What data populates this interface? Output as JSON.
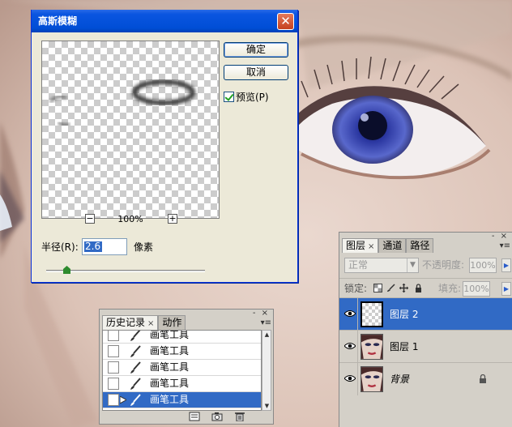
{
  "gaussian_blur_dialog": {
    "title": "高斯模糊",
    "close_symbol": "✕",
    "ok_label": "确定",
    "cancel_label": "取消",
    "preview_label": "预览(P)",
    "preview_checked": true,
    "zoom_out_symbol": "−",
    "zoom_in_symbol": "+",
    "zoom_value": "100%",
    "radius_label": "半径(R):",
    "radius_value": "2.6",
    "radius_unit": "像素",
    "radius_slider_fraction": 0.13
  },
  "history_panel": {
    "tab_history": "历史记录",
    "tab_close": "×",
    "tab_actions": "动作",
    "panel_controls": "- ×",
    "panel_menu": "▾≡",
    "items": [
      {
        "label": "画笔工具",
        "icon": "brush-icon",
        "selected": false
      },
      {
        "label": "画笔工具",
        "icon": "brush-icon",
        "selected": false
      },
      {
        "label": "画笔工具",
        "icon": "brush-icon",
        "selected": false
      },
      {
        "label": "画笔工具",
        "icon": "brush-icon",
        "selected": false
      },
      {
        "label": "画笔工具",
        "icon": "brush-icon",
        "selected": true
      }
    ],
    "footer_icons": [
      "new-document-from-state-icon",
      "snapshot-icon",
      "trash-icon"
    ]
  },
  "layers_panel": {
    "tab_layers": "图层",
    "tab_close": "×",
    "tab_channels": "通道",
    "tab_paths": "路径",
    "panel_controls": "- ×",
    "panel_menu": "▾≡",
    "blend_mode": "正常",
    "opacity_label": "不透明度:",
    "opacity_value": "100%",
    "lock_label": "锁定:",
    "fill_label": "填充:",
    "fill_value": "100%",
    "layers": [
      {
        "name": "图层 2",
        "visible": true,
        "selected": true,
        "thumbnail": "transparent",
        "locked": false
      },
      {
        "name": "图层 1",
        "visible": true,
        "selected": false,
        "thumbnail": "face",
        "locked": false
      },
      {
        "name": "背景",
        "visible": true,
        "selected": false,
        "thumbnail": "face",
        "locked": true
      }
    ]
  },
  "colors": {
    "xp_title_blue": "#0a55e0",
    "selection_blue": "#316ac5",
    "panel_gray": "#d4d0c8",
    "eye_iris": "#4a58c8"
  }
}
